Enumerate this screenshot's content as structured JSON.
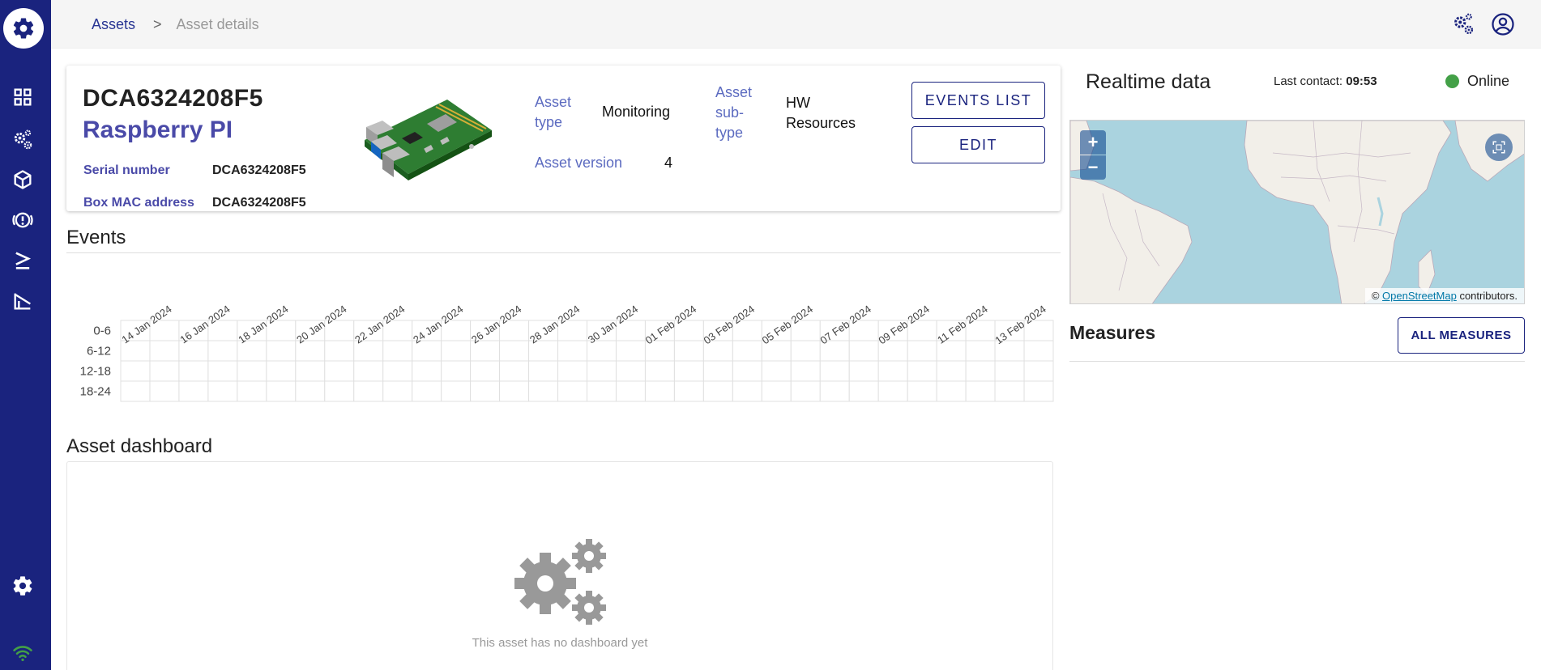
{
  "breadcrumb": {
    "root": "Assets",
    "separator": ">",
    "current": "Asset details"
  },
  "sidebar": {
    "logo_icon": "gear-icon",
    "items": [
      {
        "icon": "dashboard-grid-icon"
      },
      {
        "icon": "gears-icon"
      },
      {
        "icon": "cube-icon"
      },
      {
        "icon": "alert-icon"
      },
      {
        "icon": "terminal-icon"
      },
      {
        "icon": "chart-icon"
      }
    ],
    "bottom_items": [
      {
        "icon": "settings-icon"
      },
      {
        "icon": "wifi-icon"
      }
    ]
  },
  "topbar": {
    "settings_icon": "gears-icon",
    "account_icon": "account-circle-icon"
  },
  "asset": {
    "id": "DCA6324208F5",
    "name": "Raspberry PI",
    "serial_label": "Serial number",
    "serial_value": "DCA6324208F5",
    "mac_label": "Box MAC address",
    "mac_value": "DCA6324208F5",
    "type_label_1": "Asset",
    "type_label_2": "type",
    "type_value": "Monitoring",
    "subtype_label_1": "Asset",
    "subtype_label_2": "sub-",
    "subtype_label_3": "type",
    "subtype_value_1": "HW",
    "subtype_value_2": "Resources",
    "version_label": "Asset version",
    "version_value": "4",
    "events_list_button": "EVENTS LIST",
    "edit_button": "EDIT"
  },
  "events": {
    "title": "Events",
    "chart_data": {
      "type": "heatmap",
      "x_labels": [
        "14 Jan 2024",
        "16 Jan 2024",
        "18 Jan 2024",
        "20 Jan 2024",
        "22 Jan 2024",
        "24 Jan 2024",
        "26 Jan 2024",
        "28 Jan 2024",
        "30 Jan 2024",
        "01 Feb 2024",
        "03 Feb 2024",
        "05 Feb 2024",
        "07 Feb 2024",
        "09 Feb 2024",
        "11 Feb 2024",
        "13 Feb 2024"
      ],
      "y_labels": [
        "0-6",
        "6-12",
        "12-18",
        "18-24"
      ],
      "columns": 32,
      "values": []
    }
  },
  "dashboard": {
    "title": "Asset dashboard",
    "empty_icon": "gears-icon",
    "empty_text": "This asset has no dashboard yet"
  },
  "realtime": {
    "title": "Realtime data",
    "last_contact_label": "Last contact:",
    "last_contact_value": "09:53",
    "status": "Online",
    "status_color": "#43a047",
    "map": {
      "zoom_in": "+",
      "zoom_out": "−",
      "fullscreen_icon": "fullscreen-icon",
      "attribution_prefix": "©",
      "attribution_link": "OpenStreetMap",
      "attribution_suffix": "contributors."
    }
  },
  "measures": {
    "title": "Measures",
    "all_button": "ALL MEASURES"
  },
  "colors": {
    "sidebar": "#1a237e",
    "accent": "#4a4aa8",
    "online": "#43a047"
  }
}
